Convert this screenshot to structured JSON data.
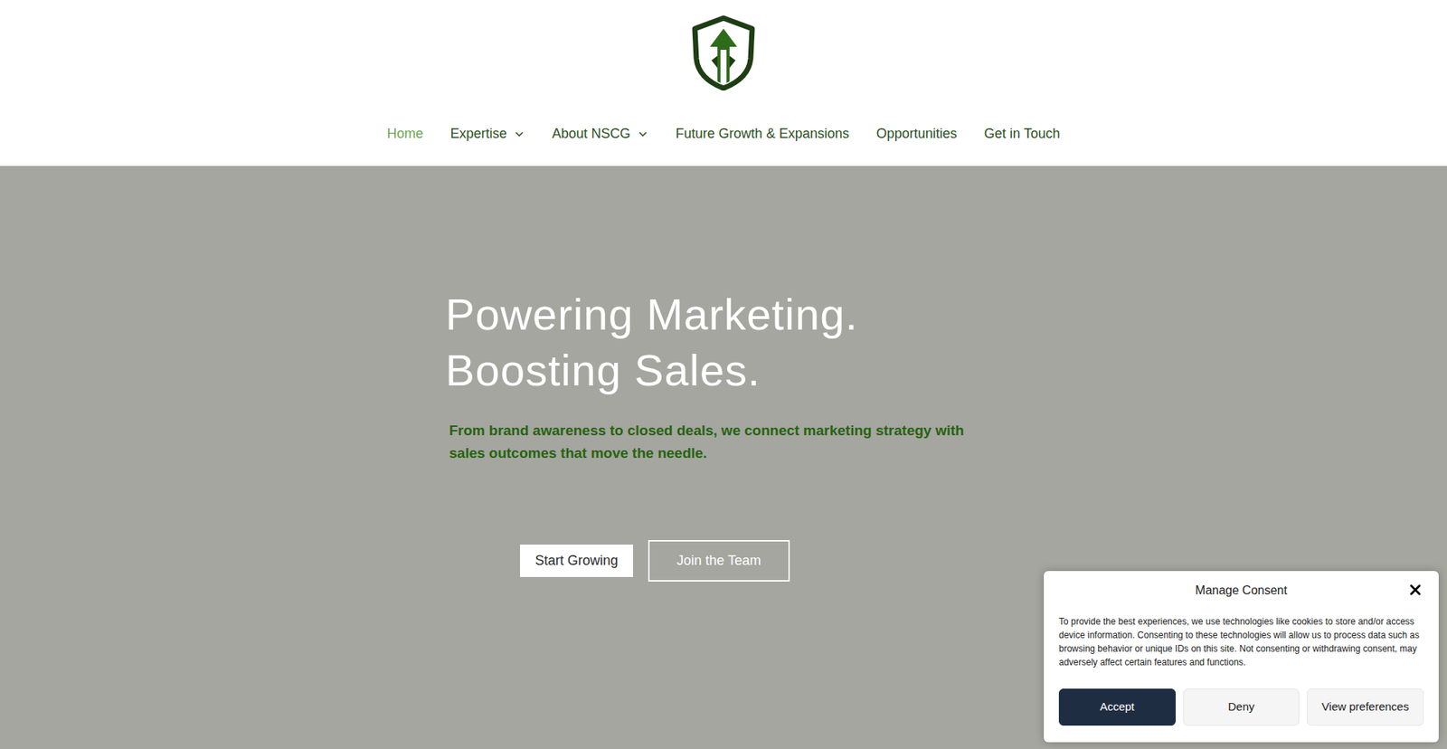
{
  "header": {
    "nav": [
      {
        "label": "Home",
        "selected": true,
        "has_dropdown": false
      },
      {
        "label": "Expertise",
        "selected": false,
        "has_dropdown": true
      },
      {
        "label": "About NSCG",
        "selected": false,
        "has_dropdown": true
      },
      {
        "label": "Future Growth & Expansions",
        "selected": false,
        "has_dropdown": false
      },
      {
        "label": "Opportunities",
        "selected": false,
        "has_dropdown": false
      },
      {
        "label": "Get in Touch",
        "selected": false,
        "has_dropdown": false
      }
    ]
  },
  "hero": {
    "title_lines": [
      "Powering Marketing.",
      "Boosting Sales."
    ],
    "subtitle": "From brand awareness to closed deals, we connect marketing strategy with sales outcomes that move the needle.",
    "buttons": [
      {
        "label": "Start Growing",
        "kind": "solid"
      },
      {
        "label": "Join the Team",
        "kind": "outline"
      }
    ]
  },
  "consent": {
    "title": "Manage Consent",
    "body": "To provide the best experiences, we use technologies like cookies to store and/or access device information. Consenting to these technologies will allow us to process data such as browsing behavior or unique IDs on this site. Not consenting or withdrawing consent, may adversely affect certain features and functions.",
    "buttons": [
      {
        "label": "Accept",
        "kind": "primary"
      },
      {
        "label": "Deny",
        "kind": "secondary"
      },
      {
        "label": "View preferences",
        "kind": "secondary"
      }
    ]
  }
}
